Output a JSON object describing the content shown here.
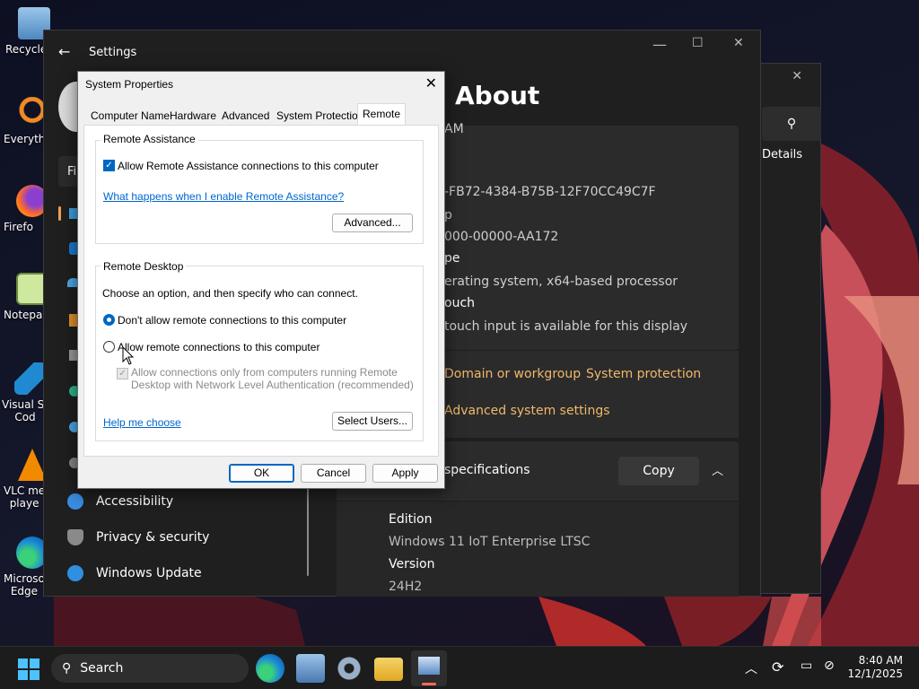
{
  "desktop": {
    "icons": [
      {
        "label": "Recycle",
        "name": "recycle-bin-desktop-icon"
      },
      {
        "label": "Everyth",
        "name": "everything-desktop-icon"
      },
      {
        "label": "Firefo",
        "name": "firefox-desktop-icon"
      },
      {
        "label": "Notepa",
        "name": "notepad-desktop-icon"
      },
      {
        "label": "Visual St\nCod",
        "name": "vscode-desktop-icon"
      },
      {
        "label": "VLC me\nplaye",
        "name": "vlc-desktop-icon"
      },
      {
        "label": "Microso\nEdge",
        "name": "edge-desktop-icon"
      }
    ]
  },
  "settings": {
    "title": "Settings",
    "page_title": "About",
    "search_placeholder": "Fi",
    "nav_items": [
      {
        "label": "Accessibility",
        "icon": "accessibility-icon"
      },
      {
        "label": "Privacy & security",
        "icon": "shield-icon"
      },
      {
        "label": "Windows Update",
        "icon": "update-icon"
      }
    ],
    "device_rows": [
      "AM",
      "-FB72-4384-B75B-12F70CC49C7F",
      "p",
      "000-00000-AA172",
      "pe",
      "erating system, x64-based processor",
      "ouch",
      "touch input is available for this display"
    ],
    "related_links": [
      "Domain or workgroup",
      "System protection",
      "Advanced system settings"
    ],
    "details_label": "Details",
    "win_spec_header": "specifications",
    "copy_label": "Copy",
    "specs": [
      {
        "label": "Edition",
        "value": "Windows 11 IoT Enterprise LTSC"
      },
      {
        "label": "Version",
        "value": "24H2"
      }
    ]
  },
  "dialog": {
    "title": "System Properties",
    "tabs": [
      "Computer Name",
      "Hardware",
      "Advanced",
      "System Protection",
      "Remote"
    ],
    "active_tab": "Remote",
    "remote_assistance": {
      "group_title": "Remote Assistance",
      "allow_label": "Allow Remote Assistance connections to this computer",
      "allow_checked": true,
      "help_link": "What happens when I enable Remote Assistance?",
      "advanced_button": "Advanced..."
    },
    "remote_desktop": {
      "group_title": "Remote Desktop",
      "instruction": "Choose an option, and then specify who can connect.",
      "option_deny": "Don't allow remote connections to this computer",
      "option_allow": "Allow remote connections to this computer",
      "selected": "deny",
      "nla_label_line1": "Allow connections only from computers running Remote",
      "nla_label_line2": "Desktop with Network Level Authentication (recommended)",
      "help_link": "Help me choose",
      "select_users_button": "Select Users..."
    },
    "buttons": {
      "ok": "OK",
      "cancel": "Cancel",
      "apply": "Apply"
    }
  },
  "taskbar": {
    "search_label": "Search",
    "time": "8:40 AM",
    "date": "12/1/2025"
  }
}
